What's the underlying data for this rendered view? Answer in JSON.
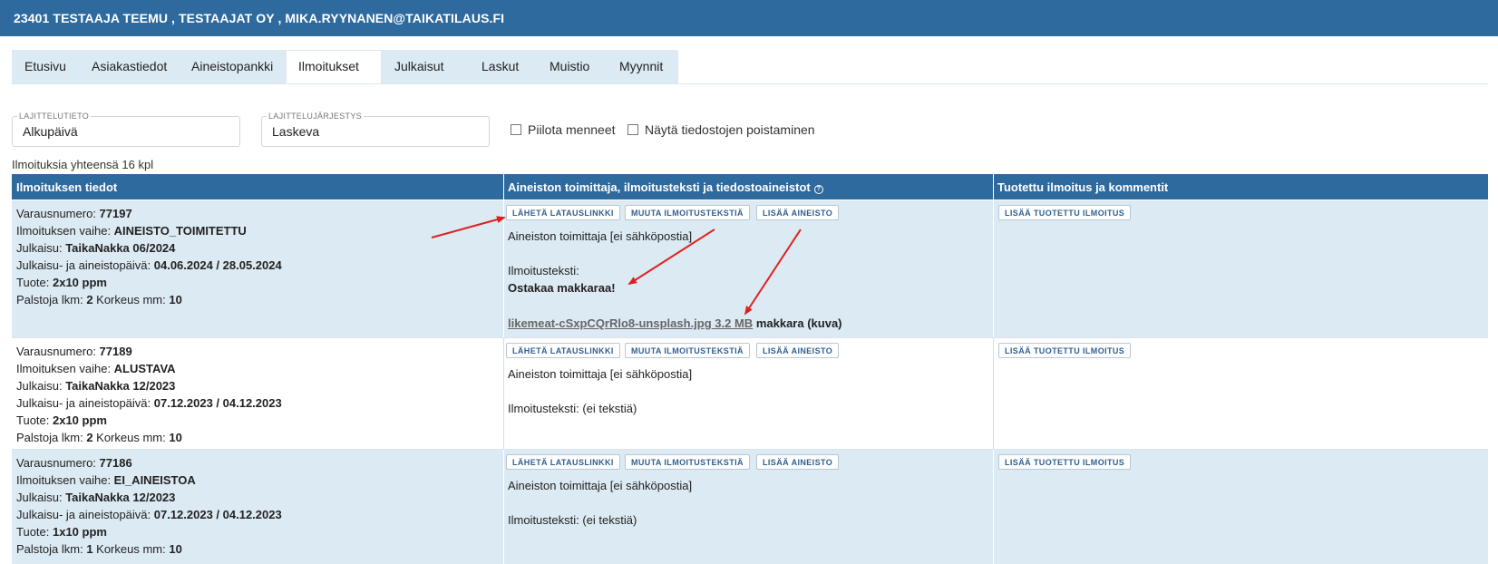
{
  "header": {
    "title": "23401 TESTAAJA TEEMU , TESTAAJAT OY , MIKA.RYYNANEN@TAIKATILAUS.FI"
  },
  "tabs": [
    {
      "label": "Etusivu"
    },
    {
      "label": "Asiakastiedot"
    },
    {
      "label": "Aineistopankki"
    },
    {
      "label": "Ilmoitukset"
    },
    {
      "label": "Julkaisut"
    },
    {
      "label": "Laskut"
    },
    {
      "label": "Muistio"
    },
    {
      "label": "Myynnit"
    }
  ],
  "active_tab": "Ilmoitukset",
  "filters": {
    "sort_field": {
      "label": "LAJITTELUTIETO",
      "value": "Alkupäivä"
    },
    "sort_order": {
      "label": "LAJITTELUJÄRJESTYS",
      "value": "Laskeva"
    },
    "hide_past": {
      "label": "Piilota menneet",
      "checked": false
    },
    "show_deletions": {
      "label": "Näytä tiedostojen poistaminen",
      "checked": false
    }
  },
  "summary": "Ilmoituksia yhteensä 16 kpl",
  "table": {
    "columns": [
      "Ilmoituksen tiedot",
      "Aineiston toimittaja, ilmoitusteksti ja tiedostoaineistot",
      "Tuotettu ilmoitus ja kommentit"
    ],
    "labels": {
      "reservation": "Varausnumero: ",
      "stage": "Ilmoituksen vaihe: ",
      "publication": "Julkaisu: ",
      "dates": "Julkaisu- ja aineistopäivä: ",
      "product": "Tuote: ",
      "columns": "Palstoja lkm: ",
      "height": " Korkeus mm: "
    },
    "buttons": {
      "send_link": "LÄHETÄ LATAUSLINKKI",
      "edit_text": "MUUTA ILMOITUSTEKSTIÄ",
      "add_material": "LISÄÄ AINEISTO",
      "add_produced": "LISÄÄ TUOTETTU ILMOITUS"
    },
    "rows": [
      {
        "reservation": "77197",
        "stage": "AINEISTO_TOIMITETTU",
        "publication": "TaikaNakka 06/2024",
        "dates": "04.06.2024 / 28.05.2024",
        "product": "2x10 ppm",
        "columns": "2",
        "height": "10",
        "supplier": "Aineiston toimittaja [ei sähköpostia]",
        "ad_text_label": "Ilmoitusteksti:",
        "ad_text": "Ostakaa makkaraa!",
        "file_name": "likemeat-cSxpCQrRlo8-unsplash.jpg",
        "file_size": "3.2 MB",
        "file_desc": "makkara (kuva)"
      },
      {
        "reservation": "77189",
        "stage": "ALUSTAVA",
        "publication": "TaikaNakka 12/2023",
        "dates": "07.12.2023 / 04.12.2023",
        "product": "2x10 ppm",
        "columns": "2",
        "height": "10",
        "supplier": "Aineiston toimittaja [ei sähköpostia]",
        "ad_text_label": "Ilmoitusteksti: (ei tekstiä)"
      },
      {
        "reservation": "77186",
        "stage": "EI_AINEISTOA",
        "publication": "TaikaNakka 12/2023",
        "dates": "07.12.2023 / 04.12.2023",
        "product": "1x10 ppm",
        "columns": "1",
        "height": "10",
        "supplier": "Aineiston toimittaja [ei sähköpostia]",
        "ad_text_label": "Ilmoitusteksti: (ei tekstiä)"
      }
    ]
  },
  "annotation_color": "#e0201f",
  "colors": {
    "header_bg": "#2f6a9e",
    "row_alt_bg": "#dceaf3"
  }
}
